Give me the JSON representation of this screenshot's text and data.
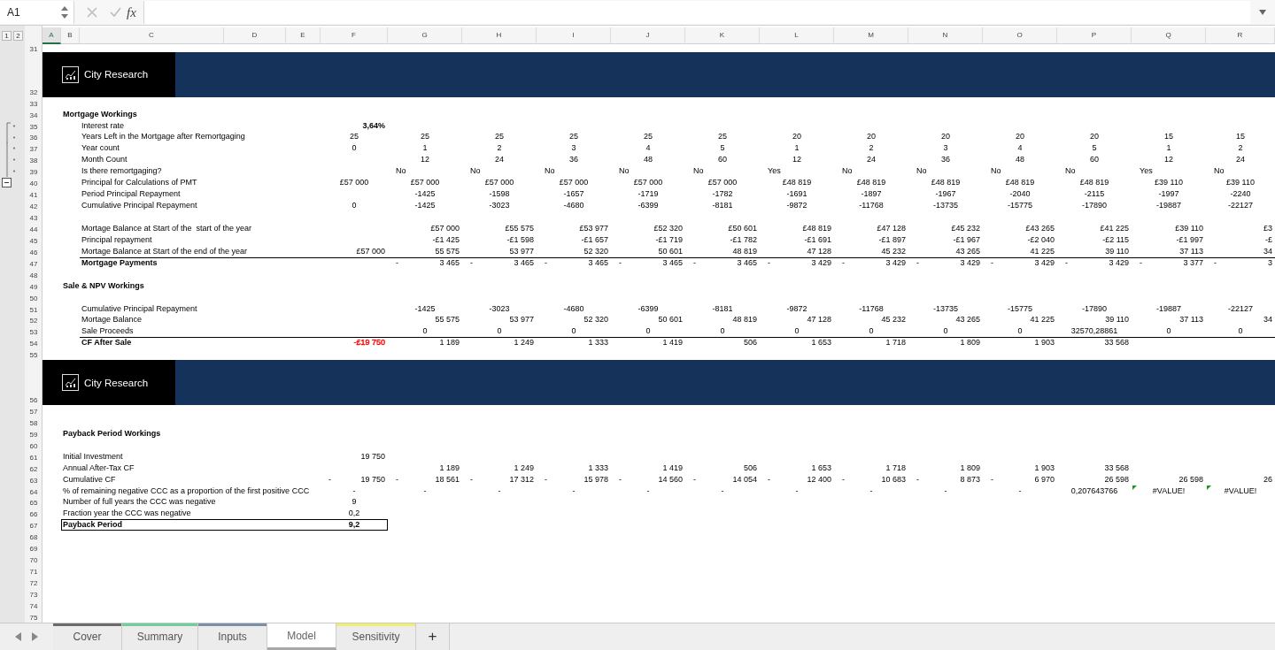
{
  "formula_bar": {
    "name_box": "A1",
    "fx": "fx"
  },
  "outline_levels": [
    "1",
    "2"
  ],
  "columns": [
    {
      "label": "A",
      "selected": true
    },
    {
      "label": "B",
      "selected": false
    },
    {
      "label": "C",
      "selected": false
    },
    {
      "label": "D",
      "selected": false
    },
    {
      "label": "E",
      "selected": false
    },
    {
      "label": "F",
      "selected": false
    },
    {
      "label": "G",
      "selected": false
    },
    {
      "label": "H",
      "selected": false
    },
    {
      "label": "I",
      "selected": false
    },
    {
      "label": "J",
      "selected": false
    },
    {
      "label": "K",
      "selected": false
    },
    {
      "label": "L",
      "selected": false
    },
    {
      "label": "M",
      "selected": false
    },
    {
      "label": "N",
      "selected": false
    },
    {
      "label": "O",
      "selected": false
    },
    {
      "label": "P",
      "selected": false
    },
    {
      "label": "Q",
      "selected": false
    },
    {
      "label": "R",
      "selected": false
    }
  ],
  "rows": [
    {
      "num": "31",
      "kind": "clipped"
    },
    {
      "num": "32",
      "kind": "banner",
      "brand": "City Research"
    },
    {
      "num": "33",
      "kind": "blank"
    },
    {
      "num": "34",
      "kind": "section",
      "cells": {
        "B": "Mortgage Workings"
      }
    },
    {
      "num": "35",
      "kind": "rate",
      "grouped": true,
      "cells": {
        "C": "Interest rate",
        "F": "3,64%"
      }
    },
    {
      "num": "36",
      "kind": "center",
      "grouped": true,
      "cells": {
        "C": "Years Left in the Mortgage after Remortgaging",
        "F": "25",
        "G": "25",
        "H": "25",
        "I": "25",
        "J": "25",
        "K": "25",
        "L": "20",
        "M": "20",
        "N": "20",
        "O": "20",
        "P": "20",
        "Q": "15",
        "R": "15"
      }
    },
    {
      "num": "37",
      "kind": "center",
      "grouped": true,
      "cells": {
        "C": "Year count",
        "F": "0",
        "G": "1",
        "H": "2",
        "I": "3",
        "J": "4",
        "K": "5",
        "L": "1",
        "M": "2",
        "N": "3",
        "O": "4",
        "P": "5",
        "Q": "1",
        "R": "2"
      }
    },
    {
      "num": "38",
      "kind": "center",
      "grouped": true,
      "cells": {
        "C": "Month Count",
        "G": "12",
        "H": "24",
        "I": "36",
        "J": "48",
        "K": "60",
        "L": "12",
        "M": "24",
        "N": "36",
        "O": "48",
        "P": "60",
        "Q": "12",
        "R": "24"
      }
    },
    {
      "num": "39",
      "kind": "flag",
      "grouped": true,
      "cells": {
        "C": "Is there remortgaging?",
        "G": "No",
        "H": "No",
        "I": "No",
        "J": "No",
        "K": "No",
        "L": "Yes",
        "M": "No",
        "N": "No",
        "O": "No",
        "P": "No",
        "Q": "Yes",
        "R": "No"
      }
    },
    {
      "num": "40",
      "kind": "center",
      "group_toggle": {
        "expanded": true
      },
      "cells": {
        "C": "Principal for Calculations of PMT",
        "F": "£57 000",
        "G": "£57 000",
        "H": "£57 000",
        "I": "£57 000",
        "J": "£57 000",
        "K": "£57 000",
        "L": "£48 819",
        "M": "£48 819",
        "N": "£48 819",
        "O": "£48 819",
        "P": "£48 819",
        "Q": "£39 110",
        "R": "£39 110"
      }
    },
    {
      "num": "41",
      "kind": "center",
      "cells": {
        "C": "Period Principal Repayment",
        "G": "-1425",
        "H": "-1598",
        "I": "-1657",
        "J": "-1719",
        "K": "-1782",
        "L": "-1691",
        "M": "-1897",
        "N": "-1967",
        "O": "-2040",
        "P": "-2115",
        "Q": "-1997",
        "R": "-2240"
      }
    },
    {
      "num": "42",
      "kind": "center",
      "cells": {
        "C": "Cumulative Principal Repayment",
        "F": "0",
        "G": "-1425",
        "H": "-3023",
        "I": "-4680",
        "J": "-6399",
        "K": "-8181",
        "L": "-9872",
        "M": "-11768",
        "N": "-13735",
        "O": "-15775",
        "P": "-17890",
        "Q": "-19887",
        "R": "-22127"
      }
    },
    {
      "num": "43",
      "kind": "blank"
    },
    {
      "num": "44",
      "kind": "right",
      "cells": {
        "C": "Mortage Balance at Start of the  start of the year",
        "G": "£57 000",
        "H": "£55 575",
        "I": "£53 977",
        "J": "£52 320",
        "K": "£50 601",
        "L": "£48 819",
        "M": "£47 128",
        "N": "£45 232",
        "O": "£43 265",
        "P": "£41 225",
        "Q": "£39 110",
        "R": "£3"
      }
    },
    {
      "num": "45",
      "kind": "right",
      "cells": {
        "C": "Principal repayment",
        "G": "-£1 425",
        "H": "-£1 598",
        "I": "-£1 657",
        "J": "-£1 719",
        "K": "-£1 782",
        "L": "-£1 691",
        "M": "-£1 897",
        "N": "-£1 967",
        "O": "-£2 040",
        "P": "-£2 115",
        "Q": "-£1 997",
        "R": "-£"
      }
    },
    {
      "num": "46",
      "kind": "right",
      "cells": {
        "C": "Mortage Balance at Start of the end of the year",
        "F": "£57 000",
        "G": "55 575",
        "H": "53 977",
        "I": "52 320",
        "J": "50 601",
        "K": "48 819",
        "L": "47 128",
        "M": "45 232",
        "N": "43 265",
        "O": "41 225",
        "P": "39 110",
        "Q": "37 113",
        "R": "34"
      }
    },
    {
      "num": "47",
      "kind": "total",
      "cells": {
        "C": "Mortgage Payments",
        "G": {
          "lead": "-",
          "text": "3 465"
        },
        "H": {
          "lead": "-",
          "text": "3 465"
        },
        "I": {
          "lead": "-",
          "text": "3 465"
        },
        "J": {
          "lead": "-",
          "text": "3 465"
        },
        "K": {
          "lead": "-",
          "text": "3 465"
        },
        "L": {
          "lead": "-",
          "text": "3 429"
        },
        "M": {
          "lead": "-",
          "text": "3 429"
        },
        "N": {
          "lead": "-",
          "text": "3 429"
        },
        "O": {
          "lead": "-",
          "text": "3 429"
        },
        "P": {
          "lead": "-",
          "text": "3 429"
        },
        "Q": {
          "lead": "-",
          "text": "3 377"
        },
        "R": {
          "lead": "-",
          "text": "3"
        }
      }
    },
    {
      "num": "48",
      "kind": "blank"
    },
    {
      "num": "49",
      "kind": "section",
      "cells": {
        "B": "Sale & NPV Workings"
      }
    },
    {
      "num": "50",
      "kind": "blank"
    },
    {
      "num": "51",
      "kind": "center",
      "cells": {
        "C": "Cumulative Principal Repayment",
        "G": "-1425",
        "H": "-3023",
        "I": "-4680",
        "J": "-6399",
        "K": "-8181",
        "L": "-9872",
        "M": "-11768",
        "N": "-13735",
        "O": "-15775",
        "P": "-17890",
        "Q": "-19887",
        "R": "-22127"
      }
    },
    {
      "num": "52",
      "kind": "right",
      "cells": {
        "C": "Mortage Balance",
        "G": "55 575",
        "H": "53 977",
        "I": "52 320",
        "J": "50 601",
        "K": "48 819",
        "L": "47 128",
        "M": "45 232",
        "N": "43 265",
        "O": "41 225",
        "P": "39 110",
        "Q": "37 113",
        "R": "34"
      }
    },
    {
      "num": "53",
      "kind": "center",
      "cells": {
        "C": "Sale Proceeds",
        "G": "0",
        "H": "0",
        "I": "0",
        "J": "0",
        "K": "0",
        "L": "0",
        "M": "0",
        "N": "0",
        "O": "0",
        "P": "32570,28861",
        "Q": "0",
        "R": "0"
      }
    },
    {
      "num": "54",
      "kind": "total",
      "cells": {
        "C": "CF After Sale",
        "F": {
          "text": "-£19 750",
          "color": "#ff0000"
        },
        "G": "1 189",
        "H": "1 249",
        "I": "1 333",
        "J": "1 419",
        "K": "506",
        "L": "1 653",
        "M": "1 718",
        "N": "1 809",
        "O": "1 903",
        "P": "33 568"
      }
    },
    {
      "num": "55",
      "kind": "blank"
    },
    {
      "num": "56",
      "kind": "banner",
      "brand": "City Research"
    },
    {
      "num": "57",
      "kind": "blank"
    },
    {
      "num": "58",
      "kind": "blank"
    },
    {
      "num": "59",
      "kind": "section",
      "cells": {
        "B": "Payback Period Workings"
      }
    },
    {
      "num": "60",
      "kind": "blank"
    },
    {
      "num": "61",
      "kind": "right",
      "cells": {
        "B": "Initial Investment",
        "F": "19 750"
      }
    },
    {
      "num": "62",
      "kind": "right",
      "cells": {
        "B": "Annual After-Tax CF",
        "G": "1 189",
        "H": "1 249",
        "I": "1 333",
        "J": "1 419",
        "K": "506",
        "L": "1 653",
        "M": "1 718",
        "N": "1 809",
        "O": "1 903",
        "P": "33 568"
      }
    },
    {
      "num": "63",
      "kind": "right",
      "cells": {
        "B": "Cumulative CF",
        "F": {
          "lead": "-",
          "text": "19 750"
        },
        "G": {
          "lead": "-",
          "text": "18 561"
        },
        "H": {
          "lead": "-",
          "text": "17 312"
        },
        "I": {
          "lead": "-",
          "text": "15 978"
        },
        "J": {
          "lead": "-",
          "text": "14 560"
        },
        "K": {
          "lead": "-",
          "text": "14 054"
        },
        "L": {
          "lead": "-",
          "text": "12 400"
        },
        "M": {
          "lead": "-",
          "text": "10 683"
        },
        "N": {
          "lead": "-",
          "text": "8 873"
        },
        "O": {
          "lead": "-",
          "text": "6 970"
        },
        "P": "26 598",
        "Q": "26 598",
        "R": "26"
      }
    },
    {
      "num": "64",
      "kind": "center",
      "cells": {
        "B": "% of remaining negative CCC as a proportion of the first positive CCC",
        "F": "-",
        "G": "-",
        "H": "-",
        "I": "-",
        "J": "-",
        "K": "-",
        "L": "-",
        "M": "-",
        "N": "-",
        "O": "-",
        "P": "0,207643766",
        "Q": {
          "text": "#VALUE!",
          "error": true
        },
        "R": {
          "text": "#VALUE!",
          "error": true
        }
      }
    },
    {
      "num": "65",
      "kind": "center",
      "cells": {
        "B": "Number of full years the CCC was negative",
        "F": "9"
      }
    },
    {
      "num": "66",
      "kind": "center",
      "cells": {
        "B": "Fraction year the CCC was negative",
        "F": "0,2"
      }
    },
    {
      "num": "67",
      "kind": "result",
      "cells": {
        "B": "Payback Period",
        "F": "9,2"
      }
    },
    {
      "num": "68",
      "kind": "blank"
    },
    {
      "num": "69",
      "kind": "blank"
    },
    {
      "num": "70",
      "kind": "blank"
    },
    {
      "num": "71",
      "kind": "blank"
    },
    {
      "num": "72",
      "kind": "blank"
    },
    {
      "num": "73",
      "kind": "blank"
    },
    {
      "num": "74",
      "kind": "blank"
    },
    {
      "num": "75",
      "kind": "blank"
    }
  ],
  "sheet_tabs": [
    {
      "label": "Cover",
      "color": "#6b6b6b",
      "selected": false
    },
    {
      "label": "Summary",
      "color": "#6dcf9a",
      "selected": false
    },
    {
      "label": "Inputs",
      "color": "#7d8fa8",
      "selected": false
    },
    {
      "label": "Model",
      "selected": true
    },
    {
      "label": "Sensitivity",
      "color": "#f0f070",
      "selected": false
    }
  ],
  "add_sheet": "+"
}
